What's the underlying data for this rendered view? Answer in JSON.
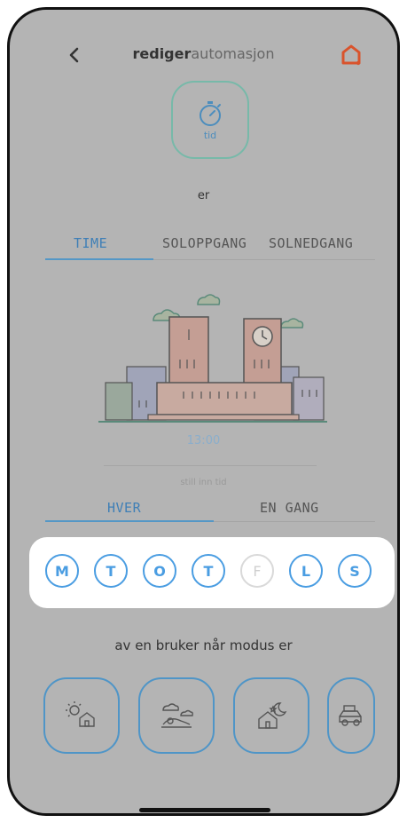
{
  "header": {
    "title_bold": "rediger",
    "title_rest": "automasjon"
  },
  "trigger": {
    "label": "tid"
  },
  "condition_text": "er",
  "time_tabs": [
    {
      "label": "TIME",
      "active": true
    },
    {
      "label": "SOLOPPGANG",
      "active": false
    },
    {
      "label": "SOLNEDGANG",
      "active": false
    }
  ],
  "time_value": "13:00",
  "time_hint": "still inn tid",
  "repeat_tabs": [
    {
      "label": "HVER",
      "active": true
    },
    {
      "label": "EN GANG",
      "active": false
    }
  ],
  "days": [
    {
      "label": "M",
      "selected": true
    },
    {
      "label": "T",
      "selected": true
    },
    {
      "label": "O",
      "selected": true
    },
    {
      "label": "T",
      "selected": true
    },
    {
      "label": "F",
      "selected": false
    },
    {
      "label": "L",
      "selected": true
    },
    {
      "label": "S",
      "selected": true
    }
  ],
  "mode_text": "av en bruker når modus er",
  "modes": [
    {
      "icon": "home-day-icon"
    },
    {
      "icon": "away-outdoor-icon"
    },
    {
      "icon": "home-night-icon"
    },
    {
      "icon": "travel-car-icon"
    }
  ],
  "colors": {
    "accent": "#4a9de2",
    "tab_active": "#5497c6",
    "trigger_border": "#77b9a9",
    "home_icon": "#d9532c",
    "overlay": "#b4b4b4"
  }
}
